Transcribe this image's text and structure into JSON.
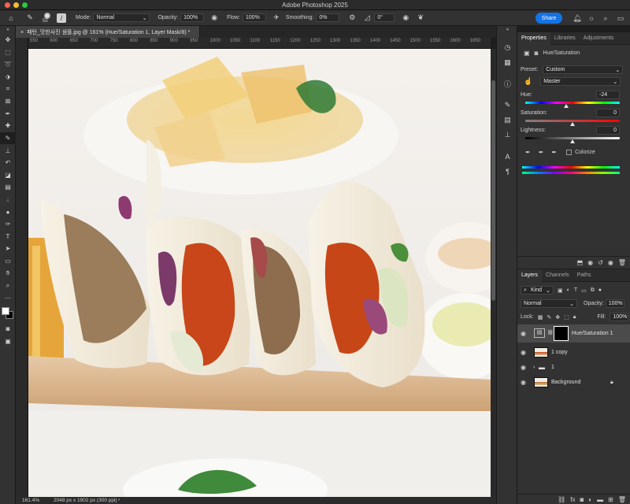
{
  "app": {
    "title": "Adobe Photoshop 2025"
  },
  "options_bar": {
    "brush_size": "55",
    "mode_label": "Mode:",
    "mode_value": "Normal",
    "opacity_label": "Opacity:",
    "opacity_value": "100%",
    "flow_label": "Flow:",
    "flow_value": "100%",
    "smoothing_label": "Smoothing:",
    "smoothing_value": "0%",
    "angle_value": "0°",
    "share_label": "Share"
  },
  "document": {
    "tab_title": "패턴_맛한사진 샘플.jpg @ 161% (Hue/Saturation 1, Layer Mask/8) *",
    "ruler_marks": [
      "550",
      "600",
      "650",
      "700",
      "750",
      "800",
      "850",
      "900",
      "950",
      "1000",
      "1050",
      "1100",
      "1150",
      "1200",
      "1250",
      "1300",
      "1350",
      "1400",
      "1450",
      "1500",
      "1550",
      "1600",
      "1650",
      "170"
    ]
  },
  "status": {
    "zoom": "161.4%",
    "doc_info": "2048 px x 1902 px (300 ppi)"
  },
  "properties": {
    "tabs": [
      "Properties",
      "Libraries",
      "Adjustments"
    ],
    "active_tab": "Properties",
    "adjustment_title": "Hue/Saturation",
    "preset_label": "Preset:",
    "preset_value": "Custom",
    "channel_value": "Master",
    "hue_label": "Hue:",
    "hue_value": "-24",
    "hue_fraction": 0.433,
    "saturation_label": "Saturation:",
    "saturation_value": "0",
    "saturation_fraction": 0.5,
    "lightness_label": "Lightness:",
    "lightness_value": "0",
    "lightness_fraction": 0.5,
    "colorize_label": "Colorize"
  },
  "layers_panel": {
    "tabs": [
      "Layers",
      "Channels",
      "Paths"
    ],
    "active_tab": "Layers",
    "filter_label": "Kind",
    "blend_mode": "Normal",
    "opacity_label": "Opacity:",
    "opacity_value": "100%",
    "lock_label": "Lock:",
    "fill_label": "Fill:",
    "fill_value": "100%",
    "layers": [
      {
        "name": "Hue/Saturation 1",
        "kind": "adjustment"
      },
      {
        "name": "1 copy",
        "kind": "pixel"
      },
      {
        "name": "1",
        "kind": "group"
      },
      {
        "name": "Background",
        "kind": "background"
      }
    ]
  },
  "colors": {
    "accent": "#1473e6",
    "panel_bg": "#323232",
    "selected_layer": "#4b4b4b"
  }
}
